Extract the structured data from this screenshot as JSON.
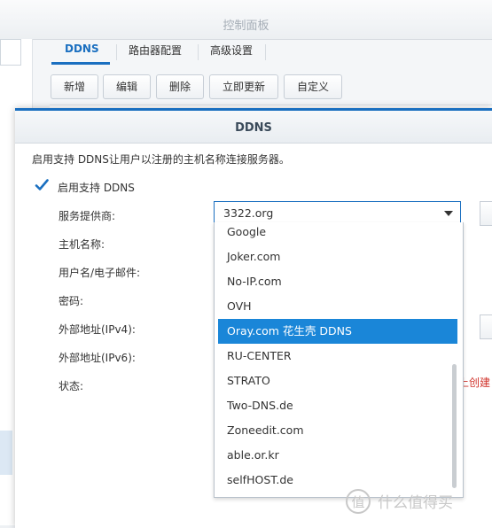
{
  "background": {
    "title": "控制面板",
    "tabs": [
      "DDNS",
      "路由器配置",
      "高级设置"
    ],
    "toolbar": [
      "新增",
      "编辑",
      "删除",
      "立即更新",
      "自定义"
    ]
  },
  "dialog": {
    "title": "DDNS",
    "description": "启用支持 DDNS让用户以注册的主机名称连接服务器。",
    "enable_label": "启用支持 DDNS",
    "enable_checked": true,
    "fields": [
      "服务提供商:",
      "主机名称:",
      "用户名/电子邮件:",
      "密码:",
      "外部地址(IPv4):",
      "外部地址(IPv6):",
      "状态:"
    ],
    "provider_value": "3322.org",
    "status_partial_text": "上创建"
  },
  "dropdown": {
    "options": [
      "Google",
      "Joker.com",
      "No-IP.com",
      "OVH",
      "Oray.com 花生壳 DDNS",
      "RU-CENTER",
      "STRATO",
      "Two-DNS.de",
      "Zoneedit.com",
      "able.or.kr",
      "selfHOST.de"
    ],
    "highlighted": "Oray.com 花生壳 DDNS"
  },
  "watermark": {
    "text": "值 什么值得买",
    "icon": "zhi-logo-icon"
  },
  "colors": {
    "accent": "#1a6fc0",
    "selection": "#1a86d8",
    "error": "#d0342c"
  }
}
